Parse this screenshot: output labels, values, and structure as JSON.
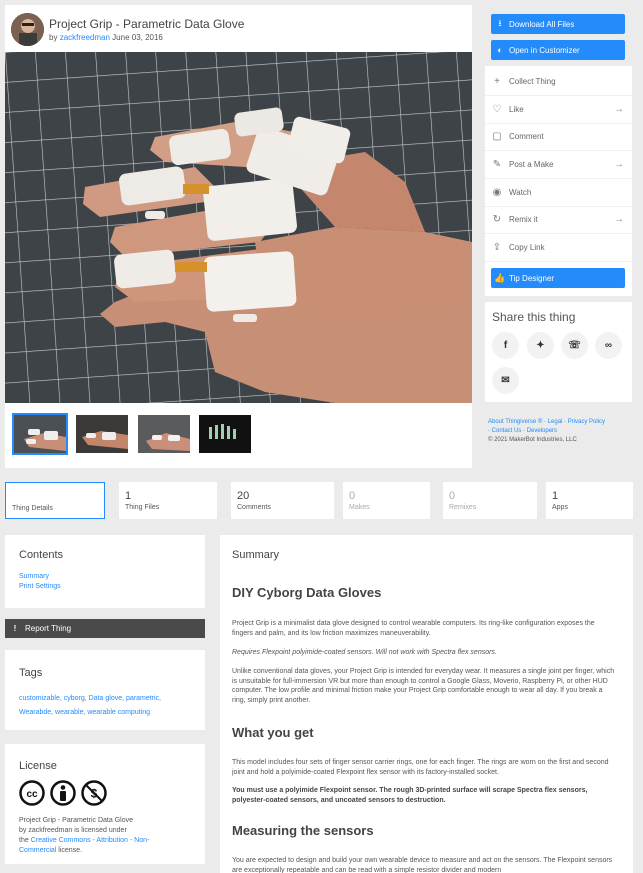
{
  "thing": {
    "title": "Project Grip - Parametric Data Glove",
    "by_label": "by",
    "author": "zackfreedman",
    "date": "June 03, 2016"
  },
  "sidebar": {
    "download_label": "Download All Files",
    "customizer_label": "Open in Customizer",
    "actions": [
      {
        "label": "Collect Thing",
        "icon": "plus-icon"
      },
      {
        "label": "Like",
        "icon": "heart-icon"
      },
      {
        "label": "Comment",
        "icon": "comment-icon"
      },
      {
        "label": "Post a Make",
        "icon": "make-icon"
      },
      {
        "label": "Watch",
        "icon": "eye-icon"
      },
      {
        "label": "Remix it",
        "icon": "remix-icon"
      },
      {
        "label": "Copy Link",
        "icon": "share-icon"
      }
    ],
    "tip_label": "Tip Designer",
    "share_title": "Share this thing"
  },
  "footer": {
    "about": "About Thingiverse ®",
    "legal": "Legal",
    "privacy": "Privacy Policy",
    "contact": "Contact Us",
    "developers": "Developers",
    "copyright": "© 2021 MakerBot Industries, LLC"
  },
  "stats": [
    {
      "num": "",
      "label": "Thing Details"
    },
    {
      "num": "1",
      "label": "Thing Files"
    },
    {
      "num": "20",
      "label": "Comments"
    },
    {
      "num": "0",
      "label": "Makes"
    },
    {
      "num": "0",
      "label": "Remixes"
    },
    {
      "num": "1",
      "label": "Apps"
    }
  ],
  "contents": {
    "title": "Contents",
    "items": [
      "Summary",
      "Print Settings"
    ]
  },
  "report_label": "Report Thing",
  "tags": {
    "title": "Tags",
    "line1": "customizable, cyborg, Data glove, parametric,",
    "line2": "Wearabde, wearable, wearable computing"
  },
  "license": {
    "title": "License",
    "line1": "Project Grip - Parametric Data Glove",
    "line2": "by zackfreedman is licensed under",
    "line3_pre": "the ",
    "line3_link": "Creative Commons - Attribution - Non-",
    "line4_link": "Commercial",
    "line4_post": " license."
  },
  "summary": {
    "label": "Summary",
    "h1": "DIY Cyborg Data Gloves",
    "p1": "Project Grip is a minimalist data glove designed to control wearable computers. Its ring-like configuration exposes the fingers and palm, and its low friction maximizes maneuverability.",
    "p2": "Requires Flexpoint polyimide-coated sensors. Will not work with Spectra flex sensors.",
    "p3": "Unlike conventional data gloves, your Project Grip is intended for everyday wear. It measures a single joint per finger, which is unsuitable for full-immersion VR but more than enough to control a Google Glass, Moverio, Raspberry Pi, or other HUD computer. The low profile and minimal friction make your Project Grip comfortable enough to wear all day. If you break a ring, simply print another.",
    "h2": "What you get",
    "p4": "This model includes four sets of finger sensor carrier rings, one for each finger. The rings are worn on the first and second joint and hold a polyimide-coated Flexpoint flex sensor with its factory-installed socket.",
    "p5": "You must use a polyimide Flexpoint sensor. The rough 3D-printed surface will scrape Spectra flex sensors, polyester-coated sensors, and uncoated sensors to destruction.",
    "h3": "Measuring the sensors",
    "p6": "You are expected to design and build your own wearable device to measure and act on the sensors. The Flexpoint sensors are exceptionally repeatable and can be read with a simple resistor divider and modern"
  }
}
